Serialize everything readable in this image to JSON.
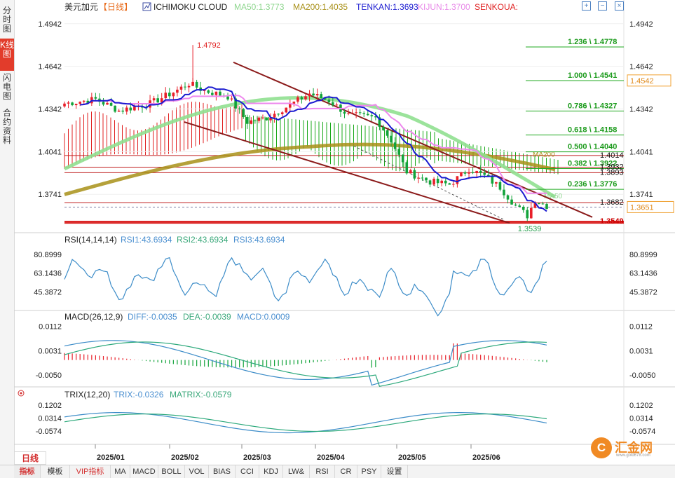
{
  "sidebar": {
    "tabs": [
      {
        "label": "分时图",
        "active": false
      },
      {
        "label": "K线图",
        "active": true
      },
      {
        "label": "闪电图",
        "active": false
      },
      {
        "label": "合约资料",
        "active": false
      }
    ]
  },
  "header": {
    "symbol": "美元加元",
    "period_tag": "【日线】",
    "indicator": "ICHIMOKU CLOUD",
    "ma50": "MA50:1.3773",
    "ma200": "MA200:1.4035",
    "tenkan": "TENKAN:1.3693",
    "kijun": "KIJUN:1.3700",
    "senkou": "SENKOUA:"
  },
  "controls": [
    "+",
    "−",
    "×"
  ],
  "colors": {
    "up": "#e8202a",
    "down": "#12a33a",
    "ma50": "#90e090",
    "ma200": "#a89018",
    "tenkan": "#1a1ad0",
    "kijun": "#ee88ee",
    "cloud_red": "#e02020",
    "cloud_green": "#18a818",
    "channel": "#8b1a1a",
    "rsi": "#3c8cc8",
    "diff": "#3c8cc8",
    "dea": "#2aa87a",
    "trix": "#3c8cc8",
    "matrix": "#2aa87a"
  },
  "chart_data": [
    {
      "type": "candlestick",
      "title": "美元加元 日线 ICHIMOKU CLOUD",
      "ylim": [
        1.352,
        1.5
      ],
      "x_months": [
        "2025/01",
        "2025/02",
        "2025/03",
        "2025/04",
        "2025/05",
        "2025/06"
      ],
      "y_ticks": [
        1.4942,
        1.4642,
        1.4342,
        1.4041,
        1.3741
      ],
      "current_price": "1.3651",
      "price_tag_1": "1.4542",
      "annotations": [
        {
          "label": "1.4792",
          "value": 1.4792
        },
        {
          "label": "1.3539",
          "value": 1.3539
        }
      ],
      "fibonacci": [
        {
          "label": "1.236 \\ 1.4778",
          "value": 1.4778
        },
        {
          "label": "1.000 \\ 1.4541",
          "value": 1.4541
        },
        {
          "label": "0.786 \\ 1.4327",
          "value": 1.4327
        },
        {
          "label": "0.618 \\ 1.4158",
          "value": 1.4158
        },
        {
          "label": "0.500 \\ 1.4040",
          "value": 1.404
        },
        {
          "label": "0.382 \\ 1.3922",
          "value": 1.3922
        },
        {
          "label": "0.236 \\ 1.3776",
          "value": 1.3776
        }
      ],
      "horizontal_levels": [
        {
          "label": "1.4014",
          "value": 1.4014
        },
        {
          "label": "1.3932",
          "value": 1.3932
        },
        {
          "label": "1.3893",
          "value": 1.3893
        },
        {
          "label": "1.3682",
          "value": 1.3682
        },
        {
          "label": "1.3549",
          "value": 1.3549
        },
        {
          "label": "1.3539",
          "value": 1.3539
        }
      ],
      "ma_labels": {
        "ma200": "MA200",
        "ma50": "MA50"
      }
    },
    {
      "type": "line",
      "title": "RSI(14,14,14)",
      "series": [
        {
          "name": "RSI1:43.6934"
        },
        {
          "name": "RSI2:43.6934"
        },
        {
          "name": "RSI3:43.6934"
        }
      ],
      "y_ticks": [
        "80.8999",
        "63.1436",
        "45.3872"
      ],
      "ylim": [
        30,
        88
      ]
    },
    {
      "type": "bar",
      "title": "MACD(26,12,9)",
      "series": [
        {
          "name": "DIFF:-0.0035"
        },
        {
          "name": "DEA:-0.0039"
        },
        {
          "name": "MACD:0.0009"
        }
      ],
      "y_ticks": [
        "0.0112",
        "0.0031",
        "-0.0050"
      ],
      "ylim": [
        -0.0085,
        0.013
      ]
    },
    {
      "type": "line",
      "title": "TRIX(12,20)",
      "series": [
        {
          "name": "TRIX:-0.0326"
        },
        {
          "name": "MATRIX:-0.0579"
        }
      ],
      "y_ticks": [
        "0.1202",
        "0.0314",
        "-0.0574"
      ],
      "ylim": [
        -0.14,
        0.16
      ]
    }
  ],
  "bottom_tabs": [
    "指标",
    "模板",
    "VIP指标",
    "MA",
    "MACD",
    "BOLL",
    "VOL",
    "BIAS",
    "CCI",
    "KDJ",
    "LW&",
    "RSI",
    "CR",
    "PSY",
    "设置"
  ],
  "period_button": "日线",
  "logo": {
    "text": "汇金网",
    "sub": "www.gold678.com",
    "mark": "C"
  }
}
